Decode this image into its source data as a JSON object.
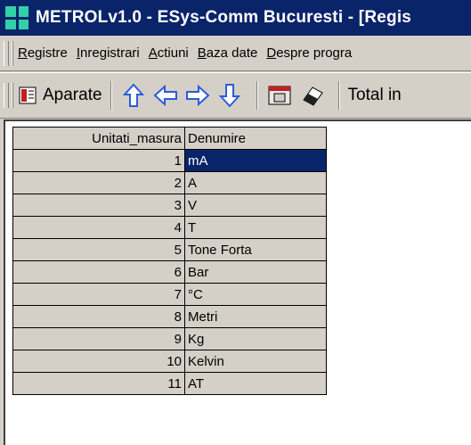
{
  "window": {
    "title": "METROLv1.0 - ESys-Comm Bucuresti  - [Regis"
  },
  "menu": {
    "items": [
      {
        "accel": "R",
        "rest": "egistre"
      },
      {
        "accel": "I",
        "rest": "nregistrari"
      },
      {
        "accel": "A",
        "rest": "ctiuni"
      },
      {
        "accel": "B",
        "rest": "aza date"
      },
      {
        "accel": "D",
        "rest": "espre progra"
      }
    ]
  },
  "toolbar": {
    "aparate_label": "Aparate",
    "total_label": "Total in",
    "icons": [
      "aparate-icon",
      "arrow-up-icon",
      "arrow-left-icon",
      "arrow-right-icon",
      "arrow-down-icon",
      "report-icon",
      "eraser-icon"
    ]
  },
  "grid": {
    "columns": [
      "Unitati_masura",
      "Denumire"
    ],
    "rows": [
      {
        "id": "1",
        "name": "mA"
      },
      {
        "id": "2",
        "name": "A"
      },
      {
        "id": "3",
        "name": "V"
      },
      {
        "id": "4",
        "name": "T"
      },
      {
        "id": "5",
        "name": "Tone Forta"
      },
      {
        "id": "6",
        "name": "Bar"
      },
      {
        "id": "7",
        "name": "°C"
      },
      {
        "id": "8",
        "name": "Metri"
      },
      {
        "id": "9",
        "name": "Kg"
      },
      {
        "id": "10",
        "name": "Kelvin"
      },
      {
        "id": "11",
        "name": "AT"
      }
    ],
    "selected_index": 0
  },
  "colors": {
    "titlebar": "#0a246a",
    "selection": "#0a246a",
    "face": "#d4d0c8",
    "arrow_fill": "#2e5bd8"
  }
}
